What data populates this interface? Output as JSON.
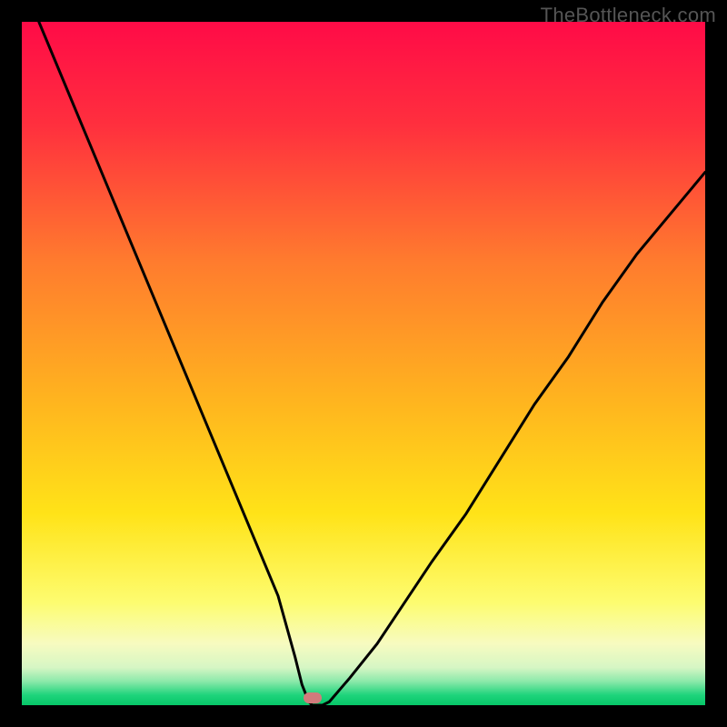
{
  "watermark": "TheBottleneck.com",
  "chart_data": {
    "type": "line",
    "title": "",
    "xlabel": "",
    "ylabel": "",
    "xlim": [
      0,
      1
    ],
    "ylim": [
      0,
      1
    ],
    "x": [
      0.025,
      0.05,
      0.075,
      0.1,
      0.125,
      0.15,
      0.175,
      0.2,
      0.225,
      0.25,
      0.275,
      0.3,
      0.325,
      0.35,
      0.375,
      0.4,
      0.41,
      0.42,
      0.425,
      0.43,
      0.44,
      0.45,
      0.48,
      0.52,
      0.56,
      0.6,
      0.65,
      0.7,
      0.75,
      0.8,
      0.85,
      0.9,
      0.95,
      1.0
    ],
    "values": [
      1.0,
      0.94,
      0.88,
      0.82,
      0.76,
      0.7,
      0.64,
      0.58,
      0.52,
      0.46,
      0.4,
      0.34,
      0.28,
      0.22,
      0.16,
      0.07,
      0.03,
      0.005,
      0.0,
      0.0,
      0.0,
      0.005,
      0.04,
      0.09,
      0.15,
      0.21,
      0.28,
      0.36,
      0.44,
      0.51,
      0.59,
      0.66,
      0.72,
      0.78
    ],
    "marker": {
      "x": 0.425,
      "y": 0.01,
      "color": "#d17b7c"
    },
    "background_gradient": [
      {
        "stop": 0.0,
        "color": "#ff0b47"
      },
      {
        "stop": 0.15,
        "color": "#ff2f3e"
      },
      {
        "stop": 0.35,
        "color": "#ff7b2e"
      },
      {
        "stop": 0.55,
        "color": "#ffb31f"
      },
      {
        "stop": 0.72,
        "color": "#ffe318"
      },
      {
        "stop": 0.85,
        "color": "#fdfc70"
      },
      {
        "stop": 0.91,
        "color": "#f7fbc0"
      },
      {
        "stop": 0.945,
        "color": "#d6f6c4"
      },
      {
        "stop": 0.965,
        "color": "#8ce9aa"
      },
      {
        "stop": 0.985,
        "color": "#1fd47c"
      },
      {
        "stop": 1.0,
        "color": "#06c667"
      }
    ]
  }
}
